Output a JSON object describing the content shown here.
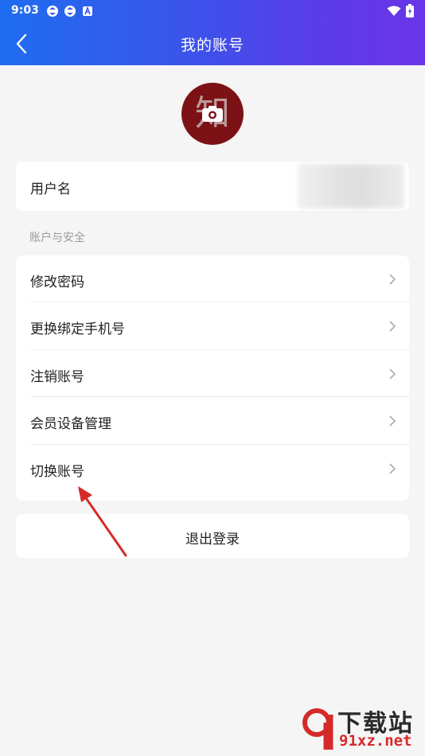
{
  "status_bar": {
    "time": "9:03",
    "icons": [
      "sync-icon",
      "sync-icon",
      "notification-a-icon"
    ],
    "right_icons": [
      "wifi-icon",
      "battery-icon"
    ]
  },
  "header": {
    "title": "我的账号",
    "back_icon": "back-arrow-icon",
    "gradient_colors": [
      "#1f6df0",
      "#6a35e6"
    ]
  },
  "profile": {
    "avatar_glyph": "知",
    "avatar_color": "#7d1216",
    "camera_icon": "camera-icon"
  },
  "username": {
    "label": "用户名"
  },
  "account_security": {
    "section_title": "账户与安全",
    "items": [
      {
        "label": "修改密码"
      },
      {
        "label": "更换绑定手机号"
      },
      {
        "label": "注销账号"
      },
      {
        "label": "会员设备管理"
      },
      {
        "label": "切换账号"
      }
    ]
  },
  "logout": {
    "label": "退出登录"
  },
  "annotation": {
    "arrow_color": "#d62a2a"
  },
  "watermark": {
    "title": "下载站",
    "url": "91xz.net"
  }
}
